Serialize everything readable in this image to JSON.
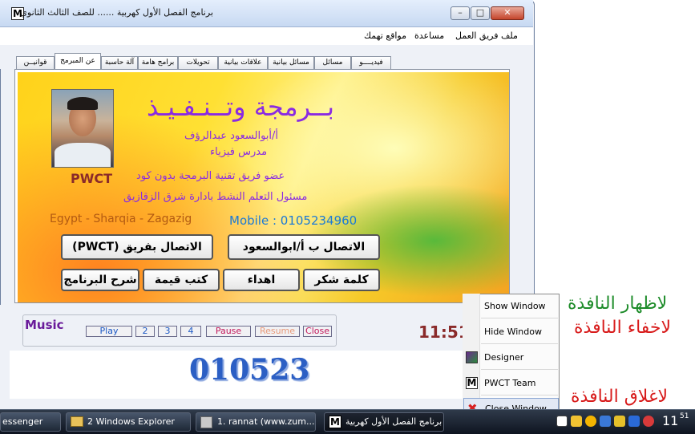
{
  "window": {
    "title": "برنامج الفصل الأول كهربية ...... للصف الثالث الثانوي",
    "app_icon": "M",
    "controls": {
      "minimize": "–",
      "maximize": "□",
      "close": "✕"
    }
  },
  "menu": [
    "ملف",
    "فريق العمل",
    "مساعدة",
    "مواقع تهمك"
  ],
  "tabs": [
    "فيديــــو",
    "مسائل",
    "مسائل بيانية",
    "علاقات بيانية",
    "تحويلات",
    "برامج هامة",
    "آلة حاسبة",
    "عن المبرمج",
    "قوانيــن"
  ],
  "about": {
    "heading": "بــرمجة  وتــنـفـيـذ",
    "author": "أ/أبوالسعود عبدالرؤف",
    "role": "مدرس فيزياء",
    "member": "عضو فريق تقنية البرمجة بدون كود",
    "pwct": "PWCT",
    "responsible": "مسئول التعلم النشط بادارة شرق الزقازيق",
    "location": "Egypt - Sharqia - Zagazig",
    "mobile": "Mobile : 0105234960"
  },
  "buttons": {
    "contact_team": "الاتصال بفريق (PWCT)",
    "contact_author": "الاتصال ب أ/ابوالسعود",
    "program_explain": "شرح البرنامج",
    "valuable_books": "كتب قيمة",
    "dedication": "اهداء",
    "thanks": "كلمة شكر"
  },
  "music": {
    "label": "Music",
    "play": "Play",
    "track2": "2",
    "track3": "3",
    "track4": "4",
    "pause": "Pause",
    "resume": "Resume",
    "close": "Close"
  },
  "timer": "11:51",
  "big_number": "010523",
  "context_menu": {
    "show": "Show Window",
    "hide": "Hide Window",
    "designer": "Designer",
    "team": "PWCT Team",
    "close": "Close Window"
  },
  "hints": {
    "show": "لاظهار النافذة",
    "hide": "لاخفاء النافذة",
    "close": "لاغلاق النافذة"
  },
  "taskbar": {
    "messenger": "essenger",
    "explorer": "2 Windows Explorer",
    "browser": "1. rannat (www.zum...",
    "app": "برنامج الفصل الأول كهربية ....",
    "clock": "11",
    "clock_sub": "51"
  },
  "colors": {
    "hint_show": "#1e8c2a",
    "hint_hide": "#d81b1b",
    "hint_close": "#d81b1b",
    "accent_purple": "#8a2be2"
  }
}
